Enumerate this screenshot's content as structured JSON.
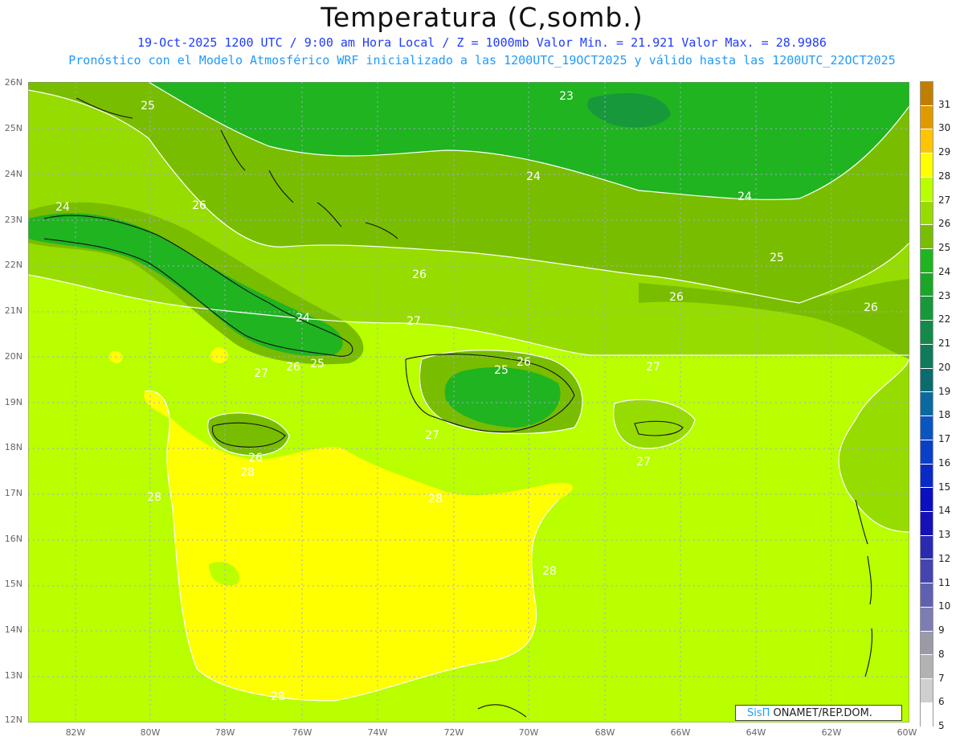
{
  "header": {
    "title": "Temperatura (C,somb.)",
    "subtitle_line1": "19-Oct-2025  1200 UTC / 9:00 am Hora Local / Z = 1000mb    Valor Min. = 21.921  Valor Max. = 28.9986",
    "subtitle_line2": "Pronóstico con el Modelo Atmosférico WRF inicializado a las 1200UTC_19OCT2025 y válido hasta las  1200UTC_22OCT2025"
  },
  "axes": {
    "lat_labels": [
      "26N",
      "25N",
      "24N",
      "23N",
      "22N",
      "21N",
      "20N",
      "19N",
      "18N",
      "17N",
      "16N",
      "15N",
      "14N",
      "13N",
      "12N"
    ],
    "lon_labels": [
      "82W",
      "80W",
      "78W",
      "76W",
      "74W",
      "72W",
      "70W",
      "68W",
      "66W",
      "64W",
      "62W",
      "60W"
    ]
  },
  "contour_labels": [
    "25",
    "23",
    "24",
    "24",
    "25",
    "26",
    "24",
    "26",
    "26",
    "26",
    "27",
    "24",
    "27",
    "26",
    "25",
    "25",
    "26",
    "27",
    "28",
    "28",
    "26",
    "27",
    "27",
    "28",
    "28",
    "28"
  ],
  "colorbar": {
    "labels": [
      "31",
      "30",
      "29",
      "28",
      "27",
      "26",
      "25",
      "24",
      "23",
      "22",
      "21",
      "20",
      "19",
      "18",
      "17",
      "16",
      "15",
      "14",
      "13",
      "12",
      "11",
      "10",
      "9",
      "8",
      "7",
      "6",
      "5"
    ],
    "colors": [
      "#c07f00",
      "#e09a00",
      "#ffc400",
      "#ffff00",
      "#b9ff00",
      "#97dc00",
      "#79bd00",
      "#20b420",
      "#1ca628",
      "#17983a",
      "#13894a",
      "#0f7b5a",
      "#0b6c6e",
      "#0a6aa0",
      "#0a56c0",
      "#0a3fc8",
      "#0a2ac8",
      "#0a10c0",
      "#1510b8",
      "#2a2ab0",
      "#4545b0",
      "#6060b0",
      "#7d7db4",
      "#9a9aa8",
      "#b2b2b2",
      "#cfcfcf",
      "#ffffff"
    ]
  },
  "credit": {
    "brand": "SisΠ",
    "text": " ONAMET/REP.DOM."
  }
}
